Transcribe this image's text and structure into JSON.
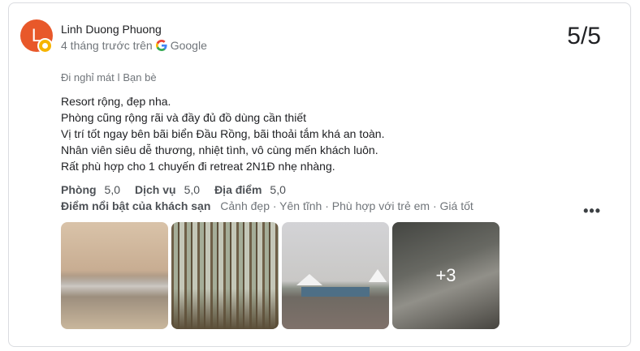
{
  "review": {
    "author": "Linh Duong Phuong",
    "avatar_letter": "L",
    "time": "4 tháng trước trên",
    "source": "Google",
    "score": "5/5",
    "trip_type": "Đi nghỉ mát",
    "trip_separator": "ǀ",
    "trip_company": "Bạn bè",
    "text_lines": [
      "Resort rộng, đẹp nha.",
      "Phòng cũng rộng rãi và đầy đủ đồ dùng cần thiết",
      "Vị trí tốt ngay bên bãi biển Đầu Rồng, bãi thoải tắm khá an toàn.",
      "Nhân viên siêu dễ thương, nhiệt tình, vô cùng mến khách luôn.",
      "Rất phù hợp cho 1 chuyến đi retreat 2N1Đ nhẹ nhàng."
    ],
    "ratings": [
      {
        "label": "Phòng",
        "value": "5,0"
      },
      {
        "label": "Dịch vụ",
        "value": "5,0"
      },
      {
        "label": "Địa điểm",
        "value": "5,0"
      }
    ],
    "highlights_label": "Điểm nổi bật của khách sạn",
    "highlights_text": "Cảnh đẹp · Yên tĩnh · Phù hợp với trẻ em · Giá tốt",
    "more_icon": "more-horizontal-icon",
    "more_label": "•••",
    "photos_more": "+3"
  },
  "colors": {
    "avatar_bg": "#e8582a",
    "badge": "#f6b400"
  }
}
